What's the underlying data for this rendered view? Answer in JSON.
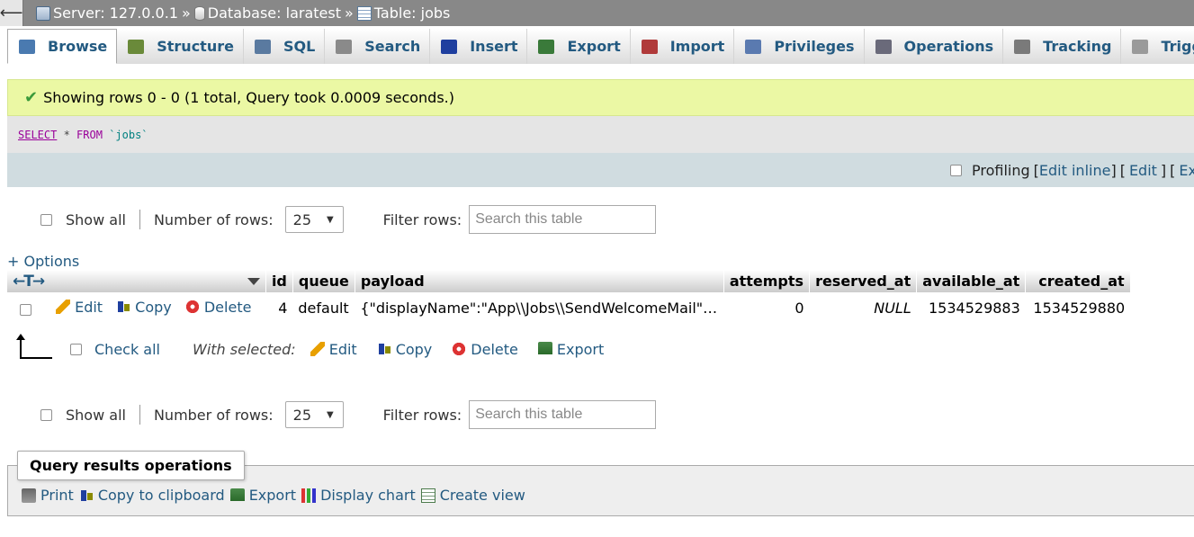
{
  "breadcrumb": {
    "back_symbol": "⟵",
    "server": "Server: 127.0.0.1",
    "database": "Database: laratest",
    "table": "Table: jobs",
    "separator": "»"
  },
  "tabs": [
    {
      "label": "Browse",
      "icon": "browse-icon",
      "color": "#4a7ab0"
    },
    {
      "label": "Structure",
      "icon": "structure-icon",
      "color": "#6a8a3a"
    },
    {
      "label": "SQL",
      "icon": "sql-icon",
      "color": "#5a7aa0"
    },
    {
      "label": "Search",
      "icon": "search-icon",
      "color": "#8a8a8a"
    },
    {
      "label": "Insert",
      "icon": "insert-icon",
      "color": "#1f3f9f"
    },
    {
      "label": "Export",
      "icon": "export-icon",
      "color": "#3a7a3a"
    },
    {
      "label": "Import",
      "icon": "import-icon",
      "color": "#b03a3a"
    },
    {
      "label": "Privileges",
      "icon": "privileges-icon",
      "color": "#5a7ab0"
    },
    {
      "label": "Operations",
      "icon": "wrench-icon",
      "color": "#6a6a7a"
    },
    {
      "label": "Tracking",
      "icon": "eye-icon",
      "color": "#7a7a7a"
    },
    {
      "label": "Triggers",
      "icon": "triggers-icon",
      "color": "#9a9a9a"
    }
  ],
  "message": {
    "text": "Showing rows 0 - 0 (1 total, Query took 0.0009 seconds.)",
    "icon": "checkmark-icon"
  },
  "sql": {
    "select": "SELECT",
    "star": " * ",
    "from": "FROM",
    "table": "`jobs`"
  },
  "profiling": {
    "label": "Profiling",
    "edit_inline": "Edit inline",
    "edit": "Edit",
    "explain": "Explai"
  },
  "nav": {
    "show_all": "Show all",
    "number_of_rows_label": "Number of rows:",
    "number_of_rows_value": "25",
    "filter_label": "Filter rows:",
    "filter_placeholder": "Search this table"
  },
  "options_label": "+ Options",
  "table": {
    "arrows_symbol": "←T→",
    "columns": [
      "id",
      "queue",
      "payload",
      "attempts",
      "reserved_at",
      "available_at",
      "created_at"
    ],
    "row_actions": {
      "edit": "Edit",
      "copy": "Copy",
      "delete": "Delete"
    },
    "rows": [
      {
        "id": "4",
        "queue": "default",
        "payload": "{\"displayName\":\"App\\\\Jobs\\\\SendWelcomeMail\",\"job\":...",
        "attempts": "0",
        "reserved_at": "NULL",
        "available_at": "1534529883",
        "created_at": "1534529880"
      }
    ]
  },
  "with_selected": {
    "check_all": "Check all",
    "label": "With selected:",
    "edit": "Edit",
    "copy": "Copy",
    "delete": "Delete",
    "export": "Export"
  },
  "query_results_operations": {
    "title": "Query results operations",
    "print": "Print",
    "copy_to_clipboard": "Copy to clipboard",
    "export": "Export",
    "display_chart": "Display chart",
    "create_view": "Create view"
  }
}
